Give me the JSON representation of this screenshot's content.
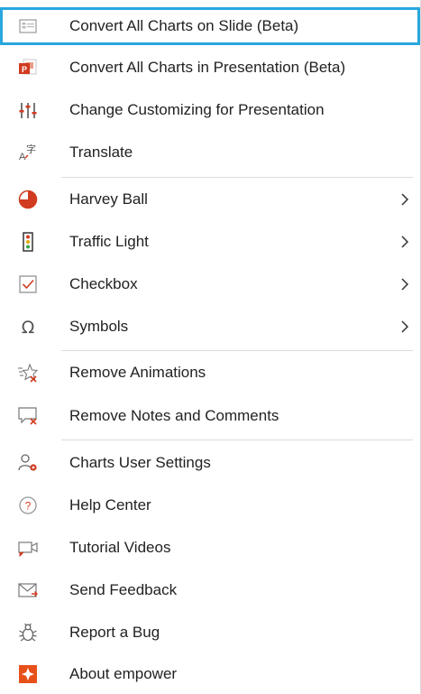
{
  "menu": {
    "items": [
      {
        "label": "Convert All Charts on Slide (Beta)",
        "icon": "slide-chart-icon"
      },
      {
        "label": "Convert All Charts in Presentation (Beta)",
        "icon": "powerpoint-icon"
      },
      {
        "label": "Change Customizing for Presentation",
        "icon": "sliders-icon"
      },
      {
        "label": "Translate",
        "icon": "translate-icon"
      },
      {
        "label": "Harvey Ball",
        "icon": "harvey-ball-icon"
      },
      {
        "label": "Traffic Light",
        "icon": "traffic-light-icon"
      },
      {
        "label": "Checkbox",
        "icon": "checkbox-icon"
      },
      {
        "label": "Symbols",
        "icon": "omega-icon"
      },
      {
        "label": "Remove Animations",
        "icon": "remove-animations-icon"
      },
      {
        "label": "Remove Notes and Comments",
        "icon": "remove-comments-icon"
      },
      {
        "label": "Charts User Settings",
        "icon": "user-settings-icon"
      },
      {
        "label": "Help Center",
        "icon": "help-icon"
      },
      {
        "label": "Tutorial Videos",
        "icon": "video-icon"
      },
      {
        "label": "Send Feedback",
        "icon": "mail-icon"
      },
      {
        "label": "Report a Bug",
        "icon": "bug-icon"
      },
      {
        "label": "About empower",
        "icon": "empower-logo-icon"
      }
    ]
  },
  "colors": {
    "selection_border": "#29a7de",
    "accent_red": "#d13b1f",
    "empower_orange": "#e8501a"
  }
}
